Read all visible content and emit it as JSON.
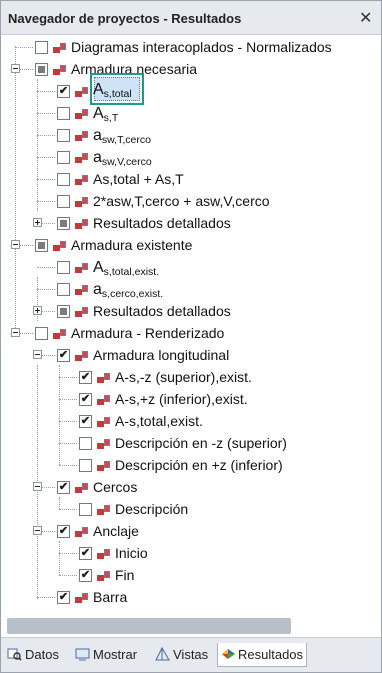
{
  "panel": {
    "title": "Navegador de proyectos - Resultados",
    "close_glyph": "✕"
  },
  "tree": [
    {
      "label": "Diagramas interacoplados - Normalizados",
      "check": "unchecked"
    },
    {
      "label": "Armadura necesaria",
      "check": "partial",
      "expander": "minus"
    },
    {
      "label": "As,total",
      "check": "checked",
      "selected": true
    },
    {
      "label": "As,T",
      "check": "unchecked"
    },
    {
      "label": "asw,T,cerco",
      "check": "unchecked"
    },
    {
      "label": "asw,V,cerco",
      "check": "unchecked"
    },
    {
      "label": "As,total + As,T",
      "check": "unchecked"
    },
    {
      "label": "2*asw,T,cerco + asw,V,cerco",
      "check": "unchecked"
    },
    {
      "label": "Resultados detallados",
      "check": "partial",
      "expander": "plus"
    },
    {
      "label": "Armadura existente",
      "check": "partial",
      "expander": "minus"
    },
    {
      "label": "As,total,exist.",
      "check": "unchecked"
    },
    {
      "label": "as,cerco,exist.",
      "check": "unchecked"
    },
    {
      "label": "Resultados detallados",
      "check": "partial",
      "expander": "plus"
    },
    {
      "label": "Armadura - Renderizado",
      "check": "unchecked",
      "expander": "minus"
    },
    {
      "label": "Armadura longitudinal",
      "check": "checked",
      "expander": "minus"
    },
    {
      "label": "A-s,-z (superior),exist.",
      "check": "checked"
    },
    {
      "label": "A-s,+z (inferior),exist.",
      "check": "checked"
    },
    {
      "label": "A-s,total,exist.",
      "check": "checked"
    },
    {
      "label": "Descripción en -z (superior)",
      "check": "unchecked"
    },
    {
      "label": "Descripción en +z (inferior)",
      "check": "unchecked"
    },
    {
      "label": "Cercos",
      "check": "checked",
      "expander": "minus"
    },
    {
      "label": "Descripción",
      "check": "unchecked"
    },
    {
      "label": "Anclaje",
      "check": "checked",
      "expander": "minus"
    },
    {
      "label": "Inicio",
      "check": "checked"
    },
    {
      "label": "Fin",
      "check": "checked"
    },
    {
      "label": "Barra",
      "check": "checked"
    }
  ],
  "label_parts": [
    {
      "base": "A",
      "sub": "s,total"
    },
    {
      "base": "A",
      "sub": "s,T"
    },
    {
      "base": "a",
      "sub": "sw,T,cerco"
    },
    {
      "base": "a",
      "sub": "sw,V,cerco"
    },
    {
      "base": "A",
      "sub": "s,total,exist."
    },
    {
      "base": "a",
      "sub": "s,cerco,exist."
    }
  ],
  "tabs": [
    {
      "label": "Datos",
      "icon": "data-icon"
    },
    {
      "label": "Mostrar",
      "icon": "display-icon"
    },
    {
      "label": "Vistas",
      "icon": "views-icon"
    },
    {
      "label": "Resultados",
      "icon": "results-icon",
      "active": true
    }
  ],
  "colors": {
    "selection_border": "#1a9c86",
    "selection_fill": "#cfe3f7",
    "header_bg": "#e6e9ee"
  }
}
